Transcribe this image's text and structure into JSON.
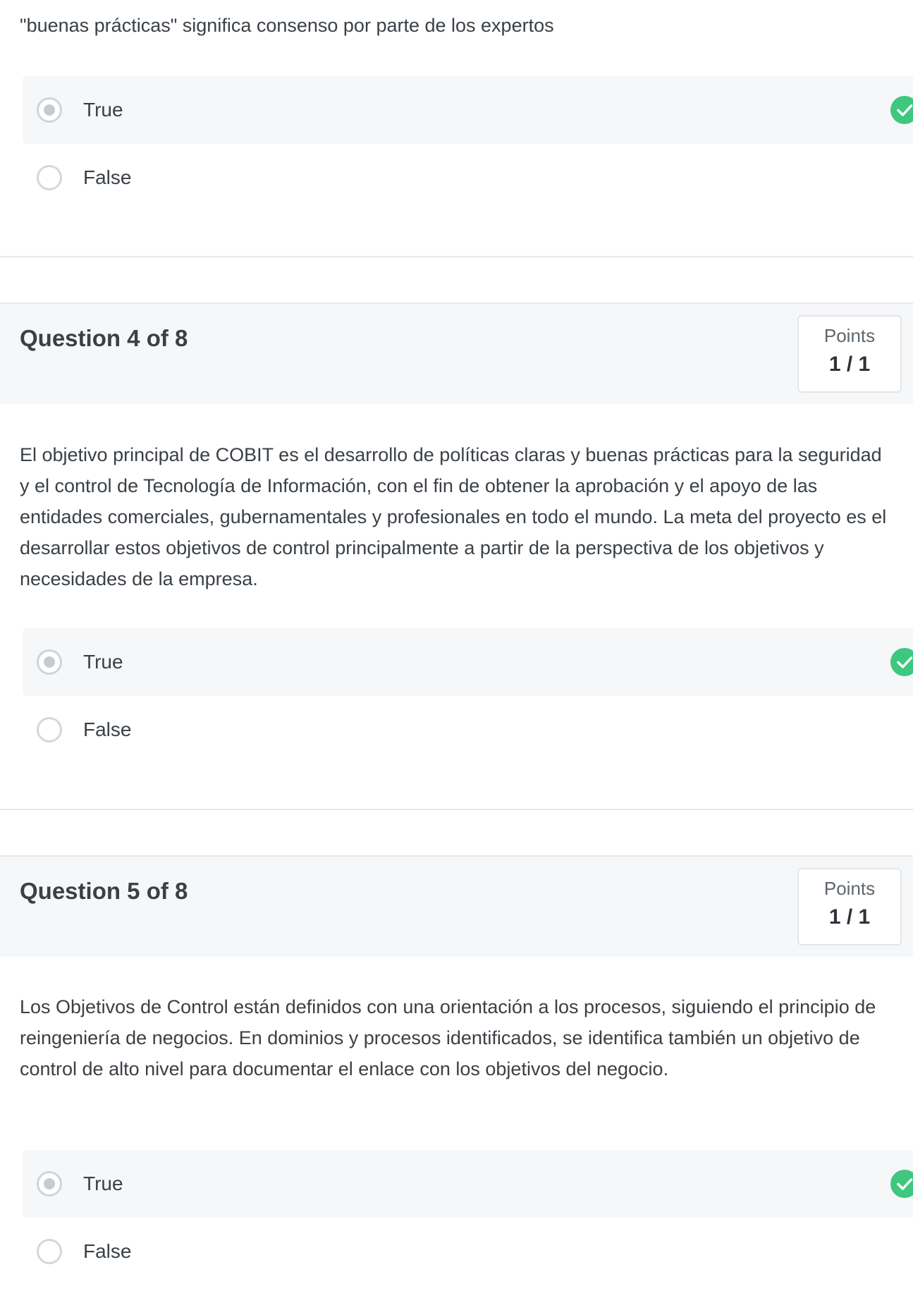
{
  "top_question": {
    "text": "\"buenas prácticas\" significa consenso por parte de los expertos",
    "options": [
      {
        "label": "True",
        "selected": true,
        "correct": true
      },
      {
        "label": "False",
        "selected": false,
        "correct": false
      }
    ]
  },
  "questions": [
    {
      "title": "Question 4 of 8",
      "points_label": "Points",
      "points_value": "1 / 1",
      "text": "El objetivo principal de COBIT es el desarrollo de políticas claras y buenas prácticas para la seguridad y el control de Tecnología de Información, con el fin de obtener la aprobación y el apoyo de las entidades comerciales, gubernamentales y profesionales en todo el mundo. La meta del proyecto es el desarrollar estos objetivos de control principalmente a partir de la perspectiva de los objetivos y necesidades de la empresa.",
      "options": [
        {
          "label": "True",
          "selected": true,
          "correct": true
        },
        {
          "label": "False",
          "selected": false,
          "correct": false
        }
      ]
    },
    {
      "title": "Question 5 of 8",
      "points_label": "Points",
      "points_value": "1 / 1",
      "text": "Los Objetivos de Control están definidos con una orientación a los procesos, siguiendo el principio de reingeniería de negocios. En dominios y procesos identificados, se identifica también un objetivo de control de alto nivel para documentar el enlace con los objetivos del negocio.",
      "options": [
        {
          "label": "True",
          "selected": true,
          "correct": true
        },
        {
          "label": "False",
          "selected": false,
          "correct": false
        }
      ]
    }
  ],
  "colors": {
    "correct_check": "#3ec77f",
    "header_bg": "#f6f7f9",
    "selected_row_bg": "#f5f7f9"
  },
  "icons": {
    "correct": "check-circle-icon",
    "radio": "radio-button"
  }
}
